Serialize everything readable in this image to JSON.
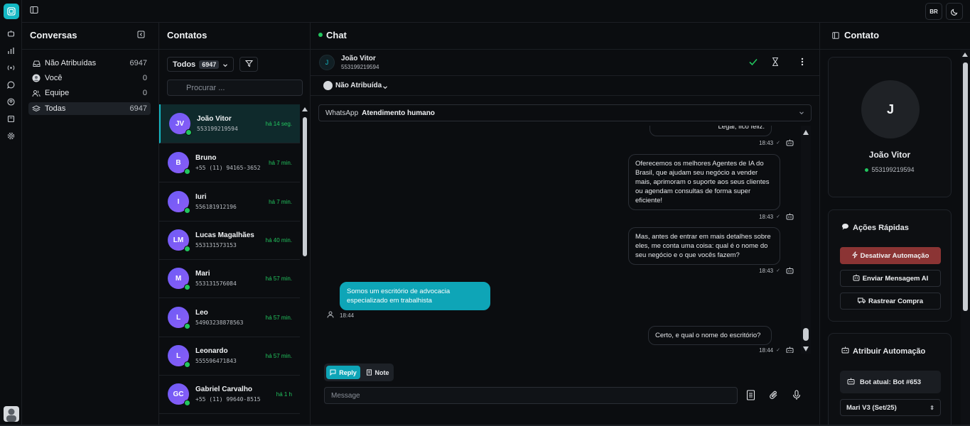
{
  "topbar": {
    "lang": "BR"
  },
  "conversas": {
    "title": "Conversas",
    "items": [
      {
        "label": "Não Atribuídas",
        "count": "6947",
        "icon": "inbox-icon"
      },
      {
        "label": "Você",
        "count": "0",
        "icon": "user-avatar-icon"
      },
      {
        "label": "Equipe",
        "count": "0",
        "icon": "team-icon"
      },
      {
        "label": "Todas",
        "count": "6947",
        "icon": "layers-icon"
      }
    ]
  },
  "contatos": {
    "title": "Contatos",
    "filter_label": "Todos",
    "filter_count": "6947",
    "search_placeholder": "Procurar ...",
    "list": [
      {
        "initials": "JV",
        "name": "João Vitor",
        "phone": "553199219594",
        "time": "há 14 seg."
      },
      {
        "initials": "B",
        "name": "Bruno",
        "phone": "+55 (11) 94165-3652",
        "time": "há 7 min."
      },
      {
        "initials": "I",
        "name": "Iuri",
        "phone": "556181912196",
        "time": "há 7 min."
      },
      {
        "initials": "LM",
        "name": "Lucas Magalhães",
        "phone": "553131573153",
        "time": "há 40 min."
      },
      {
        "initials": "M",
        "name": "Mari",
        "phone": "553131576084",
        "time": "há 57 min."
      },
      {
        "initials": "L",
        "name": "Leo",
        "phone": "5490323887856​3",
        "time": "há 57 min."
      },
      {
        "initials": "L",
        "name": "Leonardo",
        "phone": "555596471843",
        "time": "há 57 min."
      },
      {
        "initials": "GC",
        "name": "Gabriel Carvalho",
        "phone": "+55 (11) 99640-8515",
        "time": "há 1 h"
      }
    ]
  },
  "chat": {
    "title": "Chat",
    "contact_initial": "J",
    "contact_name": "João Vitor",
    "contact_phone": "553199219594",
    "assign_label": "Não Atribuída",
    "channel_label": "WhatsApp",
    "channel_value": "Atendimento humano",
    "messages": [
      {
        "dir": "out",
        "text": "Legal, fico feliz.",
        "time": "18:43"
      },
      {
        "dir": "out",
        "text": "Oferecemos os melhores Agentes de IA do Brasil, que ajudam seu negócio a vender mais, aprimoram o suporte aos seus clientes ou agendam consultas de forma super eficiente!",
        "time": "18:43"
      },
      {
        "dir": "out",
        "text": "Mas, antes de entrar em mais detalhes sobre eles, me conta uma coisa: qual é o nome do seu negócio e o que vocês fazem?",
        "time": "18:43"
      },
      {
        "dir": "in",
        "text": "Somos um escritório de advocacia especializado em trabalhista",
        "time": "18:44"
      },
      {
        "dir": "out",
        "text": "Certo, e qual o nome do escritório?",
        "time": "18:44"
      }
    ],
    "reply_label": "Reply",
    "note_label": "Note",
    "input_placeholder": "Message"
  },
  "panel": {
    "title": "Contato",
    "initial": "J",
    "name": "João Vitor",
    "phone": "553199219594",
    "quick_title": "Ações Rápidas",
    "deactivate_label": "Desativar Automação",
    "send_ai_label": "Enviar Mensagem AI",
    "track_label": "Rastrear Compra",
    "assign_title": "Atribuir Automação",
    "current_bot": "Bot atual: Bot #653",
    "bot_select": "Mari V3 (Set/25)"
  },
  "colors": {
    "accent": "#14b8c4",
    "online": "#22c55e",
    "danger": "#8b3434"
  }
}
